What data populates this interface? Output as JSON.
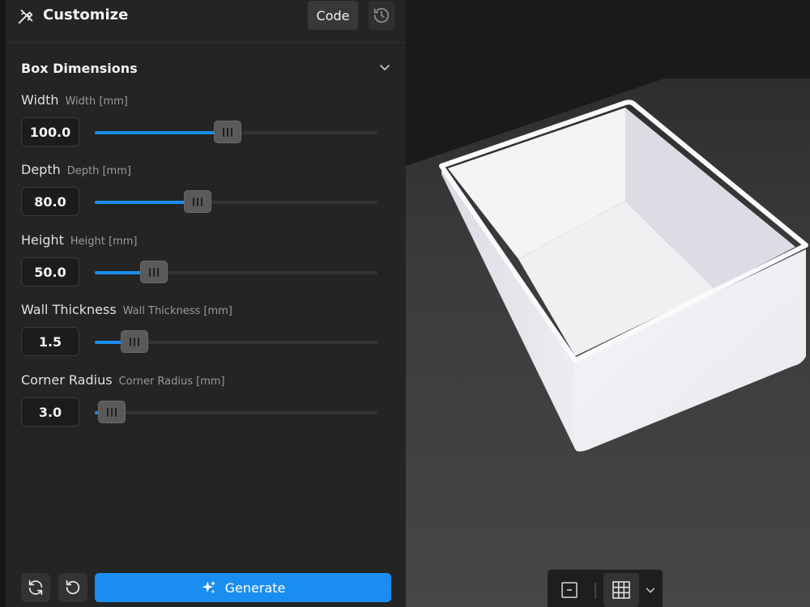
{
  "header": {
    "title": "Customize",
    "code_label": "Code"
  },
  "section": {
    "title": "Box Dimensions"
  },
  "params": [
    {
      "label": "Width",
      "sublabel": "Width [mm]",
      "value": "100.0",
      "fraction": 0.47
    },
    {
      "label": "Depth",
      "sublabel": "Depth [mm]",
      "value": "80.0",
      "fraction": 0.365
    },
    {
      "label": "Height",
      "sublabel": "Height [mm]",
      "value": "50.0",
      "fraction": 0.21
    },
    {
      "label": "Wall Thickness",
      "sublabel": "Wall Thickness [mm]",
      "value": "1.5",
      "fraction": 0.14
    },
    {
      "label": "Corner Radius",
      "sublabel": "Corner Radius [mm]",
      "value": "3.0",
      "fraction": 0.06
    }
  ],
  "footer": {
    "generate_label": "Generate"
  },
  "colors": {
    "accent": "#1a8ef0",
    "panel": "#242424",
    "viewport_background": "#1a1a1a",
    "ground": "#3c3c3c",
    "model": "#f2f2f6"
  },
  "icons": {
    "header": "pencil-ruler-icon",
    "history": "history-icon",
    "collapse": "chevron-down-icon",
    "refresh": "refresh-icon",
    "reset": "undo-icon",
    "generate": "sparkles-icon",
    "camera": "orthographic-view-icon",
    "grid": "grid-icon",
    "grid_menu": "chevron-down-icon"
  }
}
